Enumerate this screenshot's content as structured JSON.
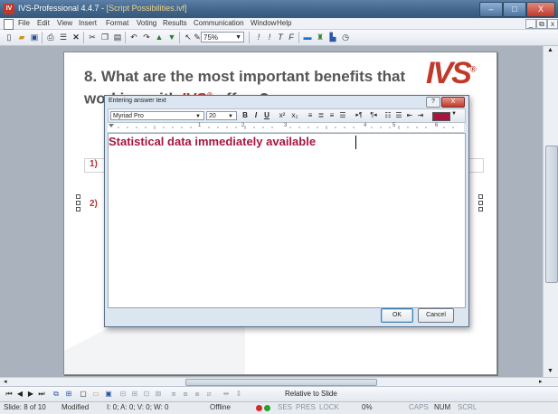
{
  "app": {
    "title_app": "IVS-Professional 4.4.7",
    "title_sep": " - ",
    "title_doc": "[Script Possibilities.ivf]",
    "min_label": "–",
    "max_label": "□",
    "close_label": "X"
  },
  "menu": {
    "items": [
      "File",
      "Edit",
      "View",
      "Insert",
      "Format",
      "Voting",
      "Results",
      "Communication",
      "Window",
      "Help"
    ],
    "mdi_min": "_",
    "mdi_restore": "⧉",
    "mdi_close": "x"
  },
  "toolbar": {
    "zoom": "75%",
    "align_left": "Ꭵ",
    "t1": "!",
    "t2": "!",
    "t3": "T",
    "t4": "F"
  },
  "slide": {
    "question_line1": "8. What are the most important benefits that",
    "question_line2a": "working with ",
    "question_brand": "IVS",
    "question_reg": "®",
    "question_line2b": " offers?",
    "logo": "IVS",
    "logo_reg": "®",
    "answer1_label": "1)",
    "answer2_label": "2)"
  },
  "dialog": {
    "title": "Entering answer text",
    "help": "?",
    "close": "X",
    "font": "Myriad Pro",
    "size": "20",
    "bold": "B",
    "italic": "I",
    "underline": "U",
    "superscript": "x²",
    "subscript": "x₂",
    "ltr": "▸¶",
    "rtl": "¶◂",
    "text_color": "#a8163f",
    "content": "Statistical data immediately available",
    "ruler_marks": [
      "1",
      "2",
      "3",
      "4",
      "5",
      "6"
    ],
    "ok": "OK",
    "cancel": "Cancel"
  },
  "bottom": {
    "relative": "Relative to Slide"
  },
  "status": {
    "slide": "Slide: 8 of 10",
    "modified": "Modified",
    "counts": "I: 0;  A: 0;  V: 0;  W: 0",
    "online": "Offline",
    "ses": "SES",
    "pres": "PRES",
    "lock": "LOCK",
    "percent": "0%",
    "caps": "CAPS",
    "num": "NUM",
    "scrl": "SCRL"
  },
  "colors": {
    "accent": "#c0392b",
    "answer_text": "#a8163f",
    "titlebar": "#3f6389"
  }
}
